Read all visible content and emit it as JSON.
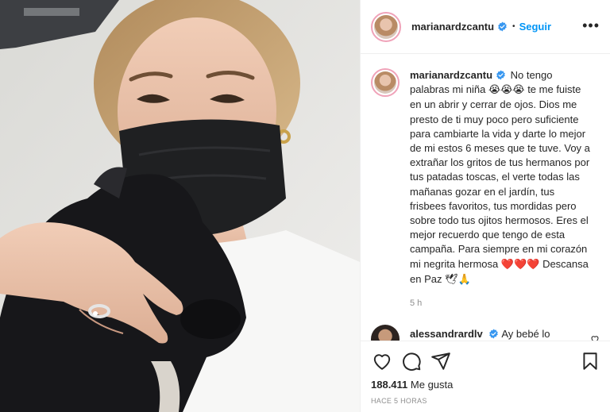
{
  "post": {
    "username": "marianardzcantu",
    "follow_label": "Seguir",
    "separator": "•",
    "more_label": "•••"
  },
  "caption": {
    "username": "marianardzcantu",
    "text_1": " No tengo palabras mi niña ",
    "emoji_1": "😭😭😭",
    "text_2": " te me fuiste en un abrir y cerrar de ojos. Dios me presto de ti muy poco pero suficiente para cambiarte la vida y darte lo mejor de mi estos 6 meses que te tuve. Voy a extrañar los gritos de tus hermanos por tus patadas toscas, el verte todas las mañanas gozar en el jardín, tus frisbees favoritos, tus mordidas pero sobre todo tus ojitos hermosos. Eres el mejor recuerdo que tengo de esta campaña. Para siempre en mi corazón mi negrita hermosa ",
    "hearts": "❤️❤️❤️",
    "text_3": " Descansa en Paz ",
    "emoji_2": "🕊🙏",
    "time": "5 h"
  },
  "comment": {
    "username": "alessandrardlv",
    "text": "Ay bebé lo"
  },
  "footer": {
    "likes_count": "188.411",
    "likes_label": " Me gusta",
    "time_ago": "HACE 5 HORAS"
  },
  "icons": {
    "like": "heart-outline-icon",
    "comment": "speech-bubble-icon",
    "share": "paper-plane-icon",
    "save": "bookmark-icon",
    "verified": "verified-badge-icon"
  },
  "colors": {
    "accent": "#0095f6",
    "verified": "#3897f0",
    "heart": "#e0213b",
    "muted": "#8e8e8e"
  }
}
